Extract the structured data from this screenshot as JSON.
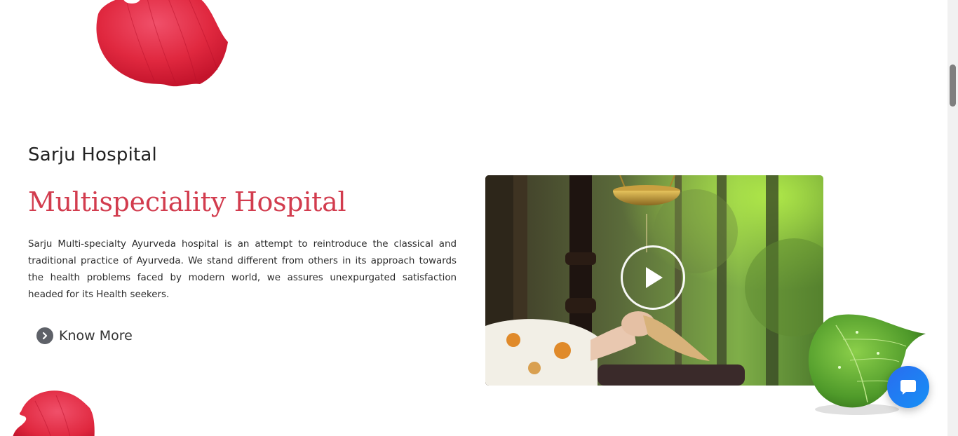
{
  "about": {
    "eyebrow": "Sarju Hospital",
    "headline": "Multispeciality Hospital",
    "description": "Sarju Multi-specialty Ayurveda hospital is an attempt to reintroduce the classical and traditional practice of Ayurveda. We stand different from others in its approach towards the health problems faced by modern world, we assures unexpurgated satisfaction headed for its Health seekers.",
    "cta_label": "Know More"
  },
  "video": {
    "icon": "play-icon"
  },
  "chat": {
    "icon": "chat-bubble-icon",
    "color": "#1e7bf3"
  },
  "colors": {
    "headline": "#d23c4e",
    "petal": "#e0283f",
    "leaf": "#4f9a2a"
  }
}
